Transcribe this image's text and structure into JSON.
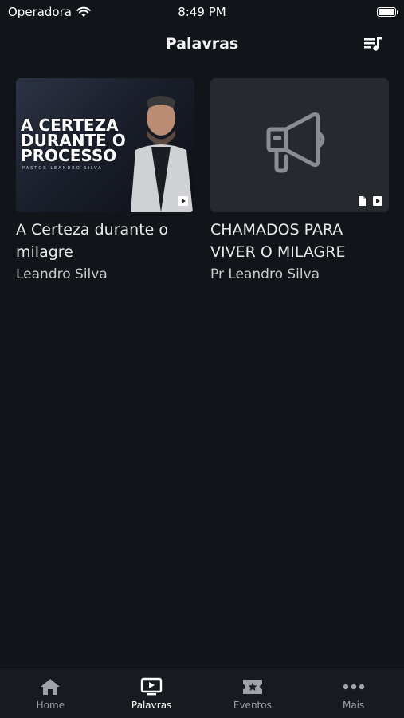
{
  "status_bar": {
    "carrier": "Operadora",
    "time": "8:49 PM"
  },
  "header": {
    "title": "Palavras"
  },
  "cards": [
    {
      "thumbnail_text": [
        "A CERTEZA",
        "DURANTE O",
        "PROCESSO"
      ],
      "thumbnail_sub": "PASTOR LEANDRO SILVA",
      "title": "A Certeza durante o milagre",
      "author": "Leandro Silva",
      "media_icons": [
        "play-icon"
      ]
    },
    {
      "title": "CHAMADOS PARA VIVER O MILAGRE",
      "author": "Pr Leandro Silva",
      "media_icons": [
        "document-icon",
        "play-icon"
      ],
      "placeholder_icon": "megaphone-icon"
    }
  ],
  "tabs": [
    {
      "label": "Home",
      "icon": "home-icon",
      "active": false
    },
    {
      "label": "Palavras",
      "icon": "video-icon",
      "active": true
    },
    {
      "label": "Eventos",
      "icon": "ticket-star-icon",
      "active": false
    },
    {
      "label": "Mais",
      "icon": "more-dots-icon",
      "active": false
    }
  ],
  "colors": {
    "background": "#111418",
    "tabbar": "#171a1f",
    "text": "#e9eaec",
    "inactive": "#9ea3aa"
  }
}
